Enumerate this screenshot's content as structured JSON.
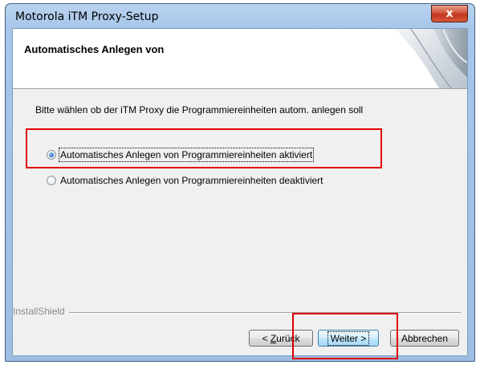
{
  "window": {
    "title": "Motorola iTM Proxy-Setup",
    "close_glyph": "x"
  },
  "banner": {
    "title": "Automatisches Anlegen von"
  },
  "instruction": "Bitte wählen ob der iTM Proxy die Programmiereinheiten autom. anlegen soll",
  "options": [
    {
      "label": "Automatisches Anlegen von Programmiereinheiten aktiviert",
      "selected": true
    },
    {
      "label": "Automatisches Anlegen von Programmiereinheiten deaktiviert",
      "selected": false
    }
  ],
  "footer": {
    "brand": "InstallShield"
  },
  "buttons": {
    "back_prefix": "< ",
    "back_mnemonic": "Z",
    "back_rest": "urück",
    "next": "Weiter >",
    "cancel": "Abbrechen"
  },
  "colors": {
    "highlight": "#e00000",
    "client_bg": "#f0f0f0"
  }
}
